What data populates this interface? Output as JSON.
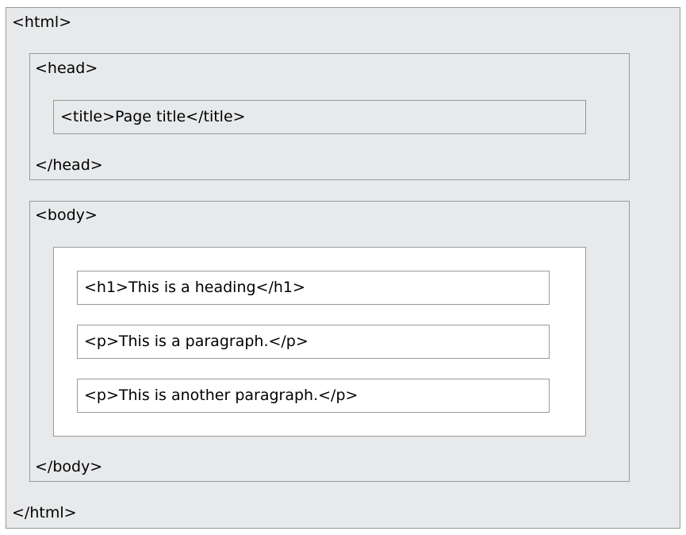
{
  "diagram": {
    "html_open": "<html>",
    "html_close": "</html>",
    "head_open": "<head>",
    "head_close": "</head>",
    "title_element": "<title>Page title</title>",
    "body_open": "<body>",
    "body_close": "</body>",
    "h1_element": "<h1>This is a heading</h1>",
    "p1_element": "<p>This is a paragraph.</p>",
    "p2_element": "<p>This is another paragraph.</p>"
  },
  "colors": {
    "outer_background": "#e7e9eb",
    "inner_background": "#ffffff",
    "border": "#999999"
  }
}
